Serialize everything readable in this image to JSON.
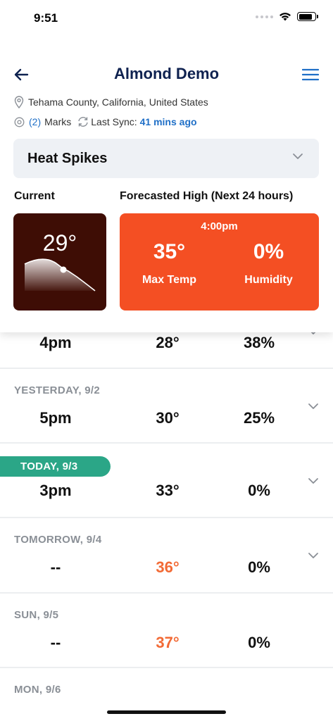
{
  "status_bar": {
    "time": "9:51"
  },
  "nav": {
    "title": "Almond Demo"
  },
  "location": {
    "text": "Tehama County, California, United States"
  },
  "marks": {
    "count": "(2)",
    "label": "Marks",
    "sync_label": "Last Sync:",
    "sync_time": "41 mins ago"
  },
  "dropdown": {
    "selected": "Heat Spikes"
  },
  "current": {
    "label": "Current",
    "temp": "29°"
  },
  "forecast": {
    "label": "Forecasted High (Next 24 hours)",
    "time": "4:00pm",
    "max_temp": "35°",
    "max_temp_label": "Max Temp",
    "humidity": "0%",
    "humidity_label": "Humidity"
  },
  "rows": [
    {
      "date": "",
      "time": "4pm",
      "temp": "28°",
      "humidity": "38%"
    },
    {
      "date": "YESTERDAY, 9/2",
      "time": "5pm",
      "temp": "30°",
      "humidity": "25%"
    },
    {
      "date": "TODAY, 9/3",
      "time": "3pm",
      "temp": "33°",
      "humidity": "0%"
    },
    {
      "date": "TOMORROW, 9/4",
      "time": "--",
      "temp": "36°",
      "humidity": "0%"
    },
    {
      "date": "SUN, 9/5",
      "time": "--",
      "temp": "37°",
      "humidity": "0%"
    },
    {
      "date": "MON, 9/6",
      "time": "",
      "temp": "",
      "humidity": ""
    }
  ],
  "colors": {
    "accent_blue": "#1f6fc7",
    "title_navy": "#0f2250",
    "forecast_orange": "#f44f23",
    "current_brown": "#3e0d05",
    "today_green": "#2ba687",
    "hot_text": "#f26a35"
  },
  "icons": [
    "back-arrow-icon",
    "hamburger-menu-icon",
    "location-pin-icon",
    "target-icon",
    "sync-icon",
    "chevron-down-icon",
    "wifi-icon",
    "battery-icon",
    "signal-icon"
  ]
}
